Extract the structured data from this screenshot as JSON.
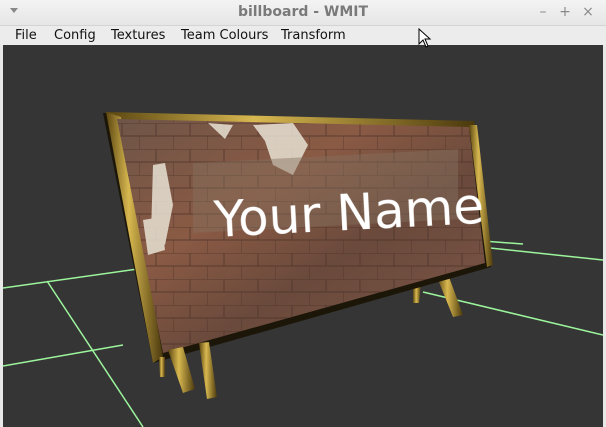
{
  "window": {
    "title": "billboard - WMIT"
  },
  "menu": {
    "items": [
      "File",
      "Config",
      "Textures",
      "Team Colours",
      "Transform"
    ]
  },
  "scene": {
    "sign_text": "Your Name",
    "grid_color": "#9cf59c",
    "frame_color": "#8a7020",
    "background_color": "#353535"
  }
}
